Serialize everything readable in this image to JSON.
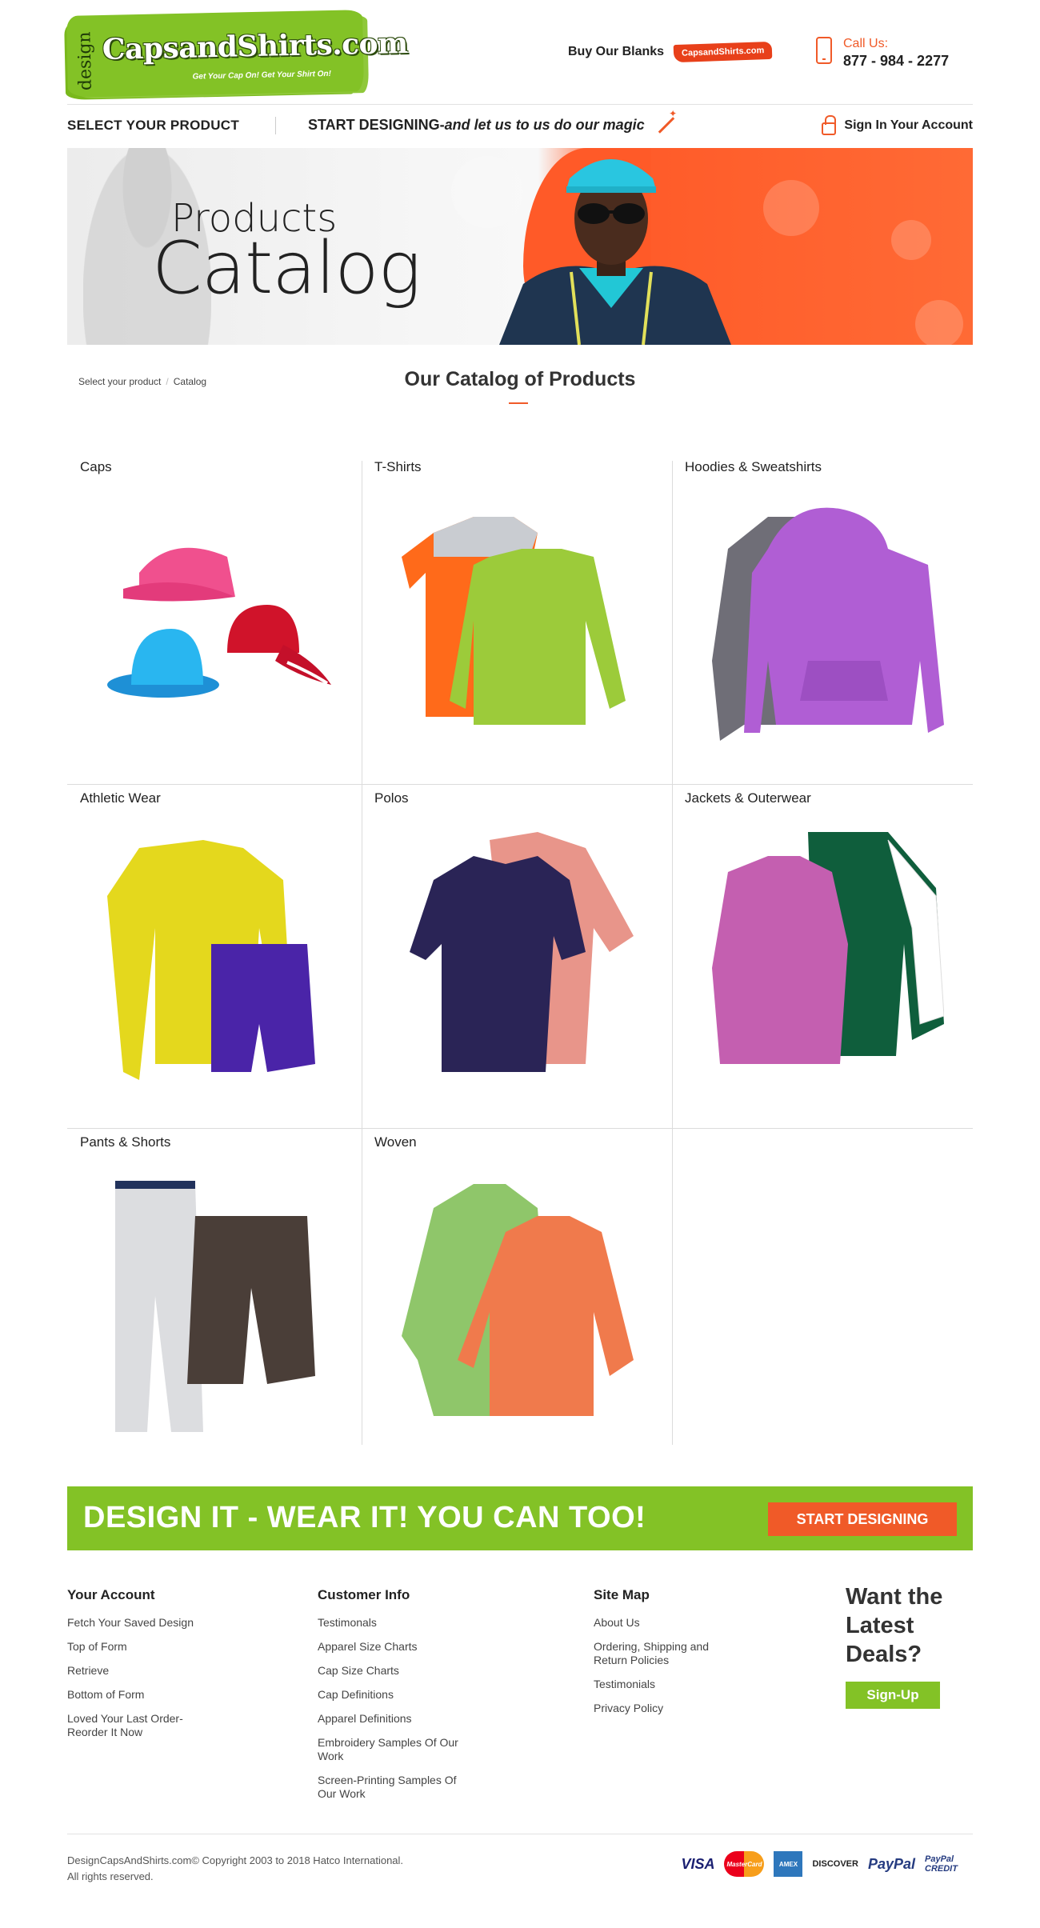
{
  "header": {
    "logo_design_word": "design",
    "logo_brand": "CapsandShirts.com",
    "logo_tagline": "Get Your Cap On! Get Your Shirt On!",
    "blanks_label": "Buy Our Blanks",
    "blanks_badge": "CapsandShirts.com",
    "call_label": "Call Us:",
    "call_number": "877 - 984 - 2277"
  },
  "nav": {
    "select_product": "SELECT YOUR PRODUCT",
    "start_designing": "START DESIGNING-",
    "start_designing_tagline": "and let us to us do our magic",
    "sign_in": "Sign In Your Account"
  },
  "hero": {
    "title_line1": "Products",
    "title_line2": "Catalog"
  },
  "breadcrumb": {
    "items": [
      "Select your product",
      "Catalog"
    ]
  },
  "catalog": {
    "title": "Our Catalog of Products",
    "products": [
      {
        "label": "Caps",
        "icon": "caps-image"
      },
      {
        "label": "T-Shirts",
        "icon": "tshirts-image"
      },
      {
        "label": "Hoodies & Sweatshirts",
        "icon": "hoodies-image"
      },
      {
        "label": "Athletic Wear",
        "icon": "athletic-wear-image"
      },
      {
        "label": "Polos",
        "icon": "polos-image"
      },
      {
        "label": "Jackets & Outerwear",
        "icon": "jackets-image"
      },
      {
        "label": "Pants & Shorts",
        "icon": "pants-shorts-image"
      },
      {
        "label": "Woven",
        "icon": "woven-image"
      }
    ]
  },
  "banner": {
    "text": "DESIGN IT - WEAR IT!  YOU CAN TOO!",
    "button": "START DESIGNING"
  },
  "footer": {
    "account": {
      "heading": "Your Account",
      "links": [
        "Fetch Your Saved Design",
        "Top of Form",
        "Retrieve",
        "Bottom of Form",
        "Loved Your Last Order-Reorder It Now"
      ]
    },
    "customer_info": {
      "heading": "Customer Info",
      "links": [
        "Testimonals",
        "Apparel Size Charts",
        "Cap Size Charts",
        "Cap Definitions",
        "Apparel Definitions",
        "Embroidery Samples Of Our Work",
        "Screen-Printing Samples Of Our Work"
      ]
    },
    "site_map": {
      "heading": "Site Map",
      "links": [
        "About Us",
        "Ordering, Shipping and Return Policies",
        "Testimonials",
        "Privacy Policy"
      ]
    },
    "deals": {
      "title": "Want the Latest Deals?",
      "button": "Sign-Up"
    },
    "copyright_line1": "DesignCapsAndShirts.com© Copyright 2003 to 2018 Hatco International.",
    "copyright_line2": "All rights reserved.",
    "payments": [
      "VISA",
      "MasterCard",
      "AMEX",
      "DISCOVER",
      "PayPal",
      "PayPal CREDIT"
    ]
  },
  "colors": {
    "accent_orange": "#f05a28",
    "accent_green": "#83c226"
  }
}
